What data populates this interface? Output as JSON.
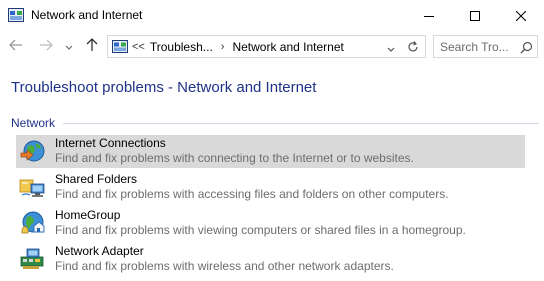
{
  "window": {
    "title": "Network and Internet",
    "icon": "control-panel-icon",
    "controls": [
      "minimize-icon",
      "maximize-icon",
      "close-icon"
    ]
  },
  "nav": {
    "back_icon": "back-arrow-icon",
    "forward_icon": "forward-arrow-icon",
    "recent_icon": "chevron-down-icon",
    "up_icon": "up-arrow-icon"
  },
  "address": {
    "overflow": "<<",
    "crumbs": [
      "Troublesh...",
      "Network and Internet"
    ],
    "refresh_icon": "refresh-icon"
  },
  "search": {
    "placeholder": "Search Tro..."
  },
  "main": {
    "title": "Troubleshoot problems - Network and Internet",
    "section": "Network",
    "items": [
      {
        "title": "Internet Connections",
        "description": "Find and fix problems with connecting to the Internet or to websites.",
        "icon": "globe-connection-icon",
        "selected": true
      },
      {
        "title": "Shared Folders",
        "description": "Find and fix problems with accessing files and folders on other computers.",
        "icon": "shared-folder-icon",
        "selected": false
      },
      {
        "title": "HomeGroup",
        "description": "Find and fix problems with viewing computers or shared files in a homegroup.",
        "icon": "homegroup-icon",
        "selected": false
      },
      {
        "title": "Network Adapter",
        "description": "Find and fix problems with wireless and other network adapters.",
        "icon": "network-adapter-icon",
        "selected": false
      }
    ]
  },
  "colors": {
    "heading": "#1e3287",
    "selected_row": "#d9d9d9",
    "description_text": "#6d6d6d"
  }
}
